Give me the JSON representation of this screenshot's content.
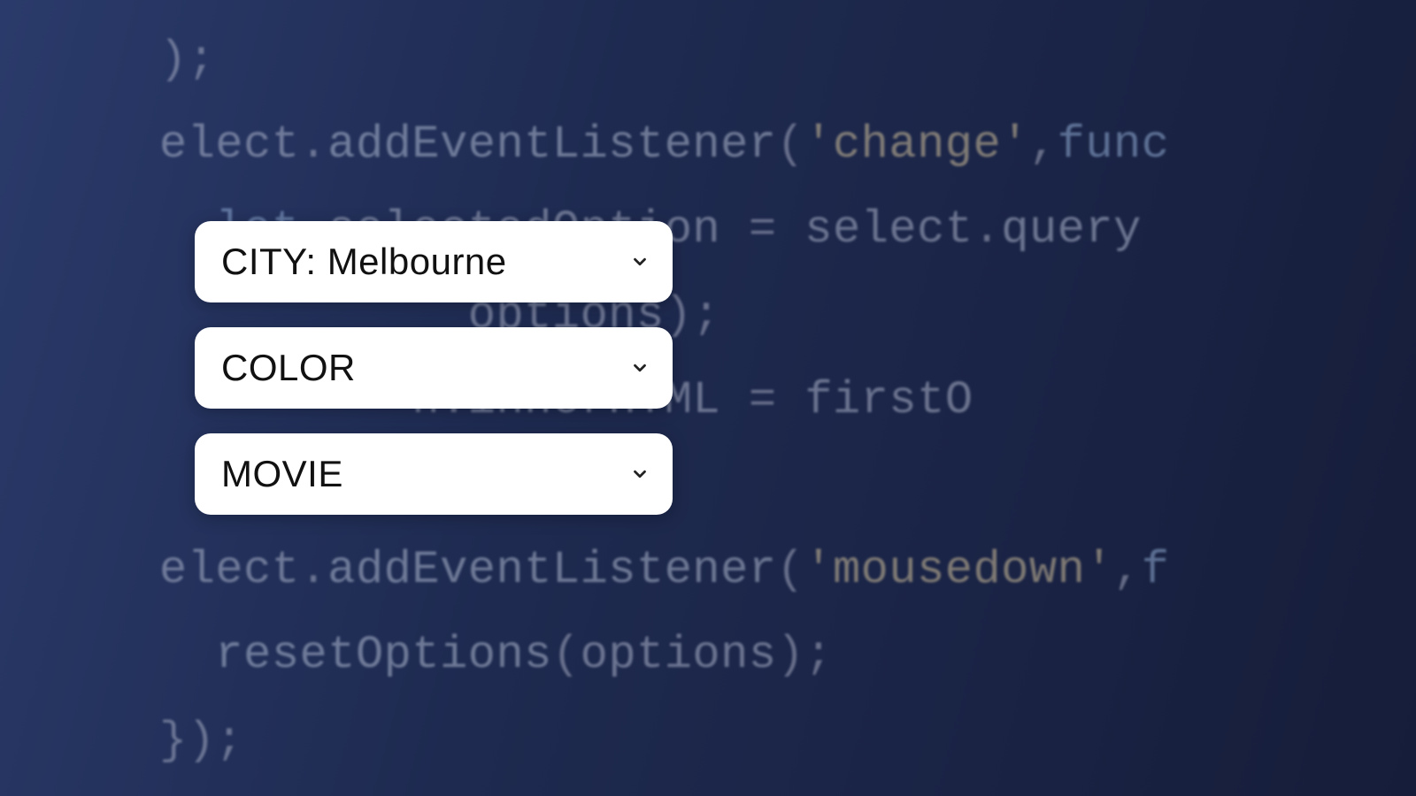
{
  "dropdowns": [
    {
      "label": "CITY: Melbourne"
    },
    {
      "label": "COLOR"
    },
    {
      "label": "MOVIE"
    }
  ],
  "code_lines": [
    ");",
    "elect.addEventListener('change',func",
    "  let selectedOption = select.query",
    "           options);",
    "         n.innerHTML = firstO",
    "",
    "elect.addEventListener('mousedown',f",
    "  resetOptions(options);",
    "});"
  ]
}
